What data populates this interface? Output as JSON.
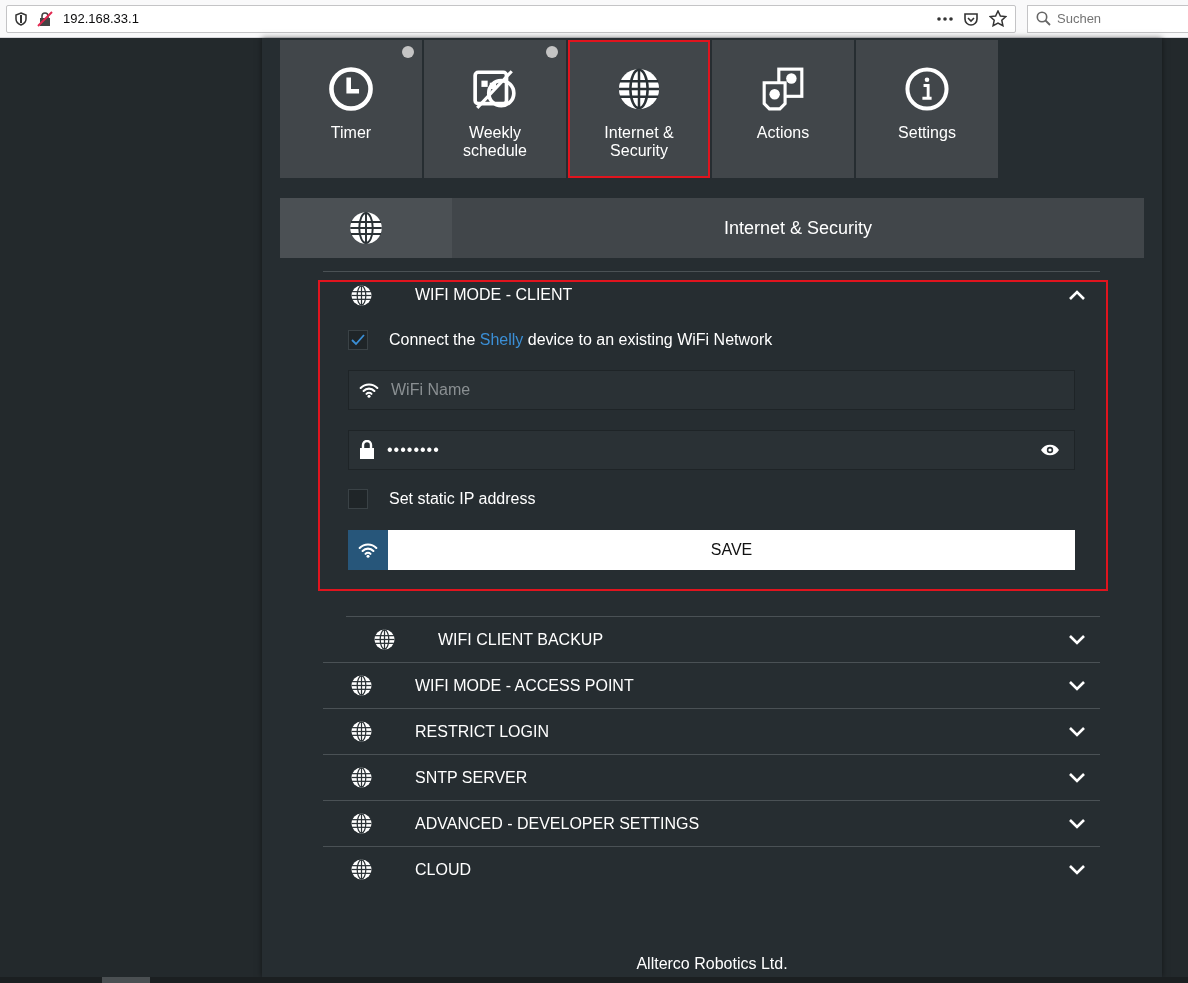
{
  "browser": {
    "url": "192.168.33.1",
    "search_placeholder": "Suchen"
  },
  "tiles": [
    {
      "label": "Timer",
      "kind": "clock",
      "selected": false,
      "indicator": true
    },
    {
      "label": "Weekly schedule",
      "kind": "schedule",
      "selected": false,
      "indicator": true
    },
    {
      "label": "Internet & Security",
      "kind": "globe",
      "selected": true,
      "indicator": false
    },
    {
      "label": "Actions",
      "kind": "actions",
      "selected": false,
      "indicator": false
    },
    {
      "label": "Settings",
      "kind": "info",
      "selected": false,
      "indicator": false
    }
  ],
  "page_header": {
    "title": "Internet & Security"
  },
  "sections": [
    {
      "title": "WIFI MODE - CLIENT",
      "expanded": true,
      "form": {
        "connect": {
          "checked": true,
          "text_before": "Connect the ",
          "link": "Shelly",
          "text_after": " device to an existing WiFi Network"
        },
        "wifi_name": {
          "placeholder": "WiFi Name"
        },
        "password": {
          "value": "••••••••"
        },
        "static_ip": {
          "checked": false,
          "label": "Set static IP address"
        },
        "save": "SAVE"
      },
      "children": [
        {
          "title": "WIFI CLIENT BACKUP",
          "expanded": false
        }
      ]
    },
    {
      "title": "WIFI MODE - ACCESS POINT",
      "expanded": false
    },
    {
      "title": "RESTRICT LOGIN",
      "expanded": false
    },
    {
      "title": "SNTP SERVER",
      "expanded": false
    },
    {
      "title": "ADVANCED - DEVELOPER SETTINGS",
      "expanded": false
    },
    {
      "title": "CLOUD",
      "expanded": false
    }
  ],
  "footer": "Allterco Robotics Ltd."
}
